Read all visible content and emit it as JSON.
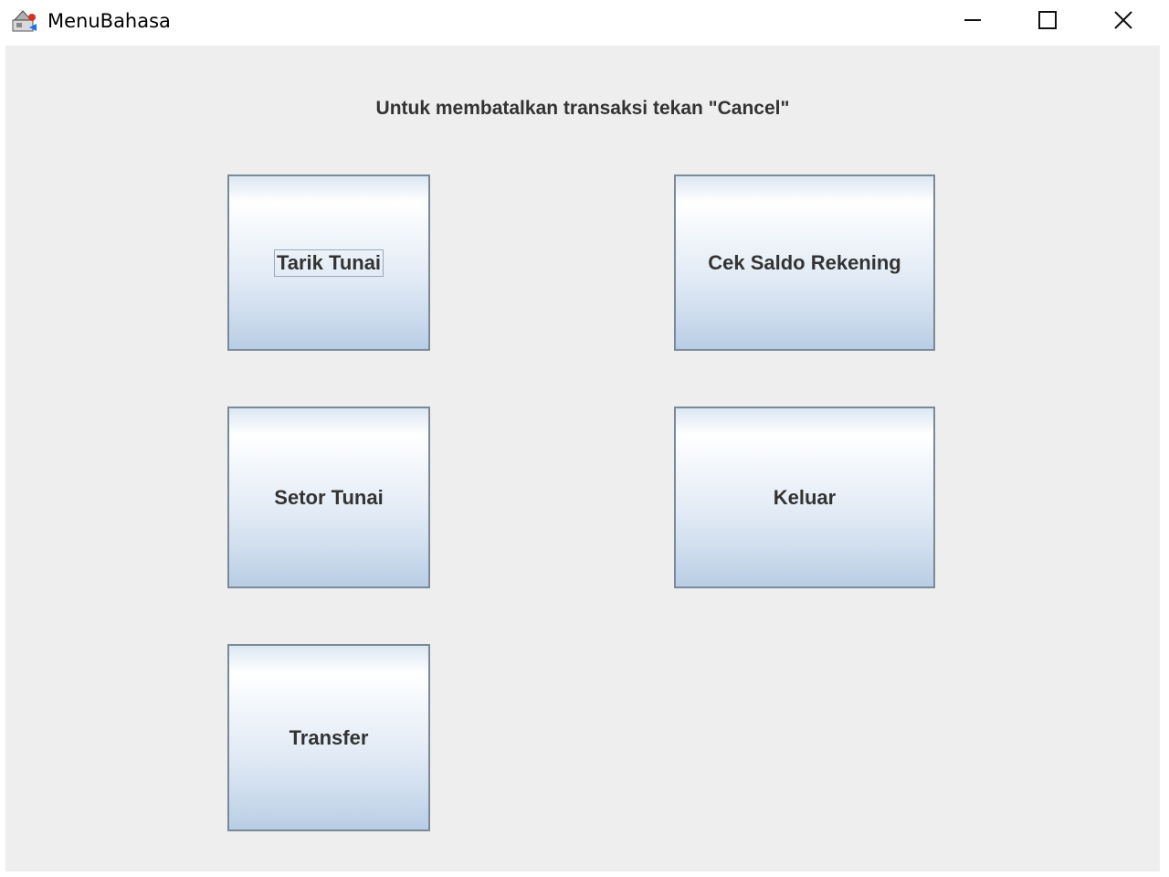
{
  "window": {
    "title": "MenuBahasa",
    "icon": "java-app-icon",
    "controls": {
      "minimize_icon": "minimize-icon",
      "maximize_icon": "maximize-icon",
      "close_icon": "close-icon"
    }
  },
  "content": {
    "instruction": "Untuk membatalkan transaksi tekan \"Cancel\""
  },
  "buttons": {
    "tarik_tunai": "Tarik Tunai",
    "cek_saldo": "Cek Saldo Rekening",
    "setor_tunai": "Setor Tunai",
    "keluar": "Keluar",
    "transfer": "Transfer"
  },
  "colors": {
    "content_background": "#eeeeee",
    "button_border": "#7a8a99",
    "button_gradient_top": "#ffffff",
    "button_gradient_bottom": "#b8cde4",
    "text": "#333333"
  }
}
